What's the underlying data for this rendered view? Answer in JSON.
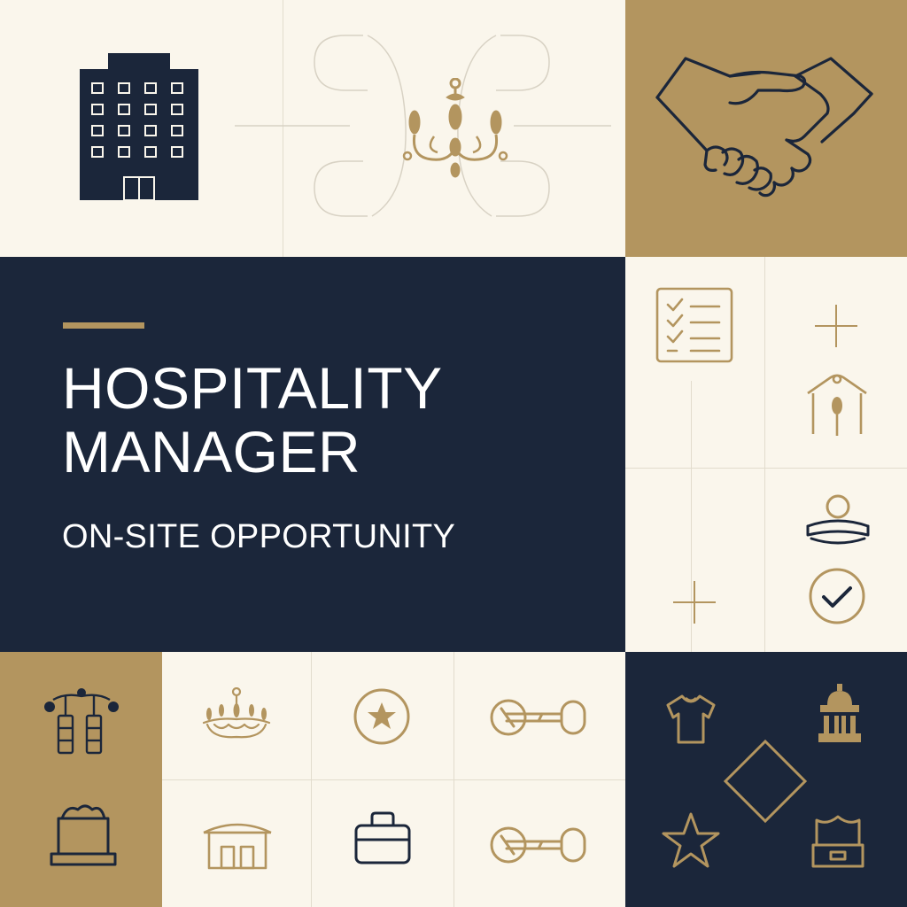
{
  "hero": {
    "title_line1": "HOSPITALITY",
    "title_line2": "MANAGER",
    "subtitle": "ON-SITE OPPORTUNITY"
  },
  "colors": {
    "navy": "#1B263A",
    "gold": "#B3955F",
    "cream": "#FAF6EC"
  },
  "icons": [
    "hotel-building-icon",
    "chandelier-icon",
    "handshake-icon",
    "checklist-icon",
    "plus-icon",
    "concierge-icon",
    "guest-service-icon",
    "check-circle-icon",
    "pendant-lights-icon",
    "chandelier-small-icon",
    "star-badge-icon",
    "key-icon",
    "mountain-tray-icon",
    "resort-building-icon",
    "luggage-icon",
    "shirt-icon",
    "temple-icon",
    "diamond-icon",
    "star-icon",
    "reception-desk-icon"
  ]
}
